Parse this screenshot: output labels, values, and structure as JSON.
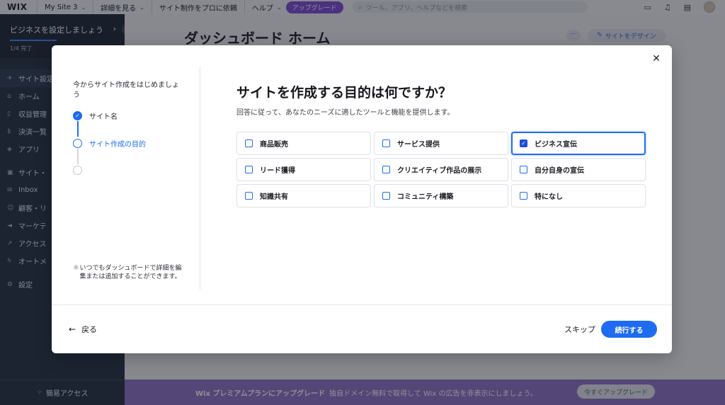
{
  "topbar": {
    "logo": "WIX",
    "site_name": "My Site 3",
    "menu": [
      "詳細を見る",
      "サイト制作をプロに依頼",
      "ヘルプ"
    ],
    "upgrade": "アップグレード",
    "search_placeholder": "ツール、アプリ、ヘルプなどを検索"
  },
  "sidebar": {
    "setup_title": "ビジネスを設定しましょう",
    "setup_progress": "1/4 完了",
    "setup_progress_fraction": 0.25,
    "items": [
      "サイト設定",
      "ホーム",
      "収益管理",
      "決済一覧",
      "アプリ",
      "サイト・",
      "Inbox",
      "顧客・リ",
      "マーケテ",
      "アクセス",
      "オートメ",
      "設定"
    ],
    "easy_access": "簡易アクセス"
  },
  "main": {
    "page_title": "ダッシュボード ホーム",
    "design_button": "サイトをデザイン"
  },
  "promo": {
    "strong": "Wix プレミアムプランにアップグレード",
    "text": "独自ドメイン無料で取得して Wix の広告を非表示にしましょう。",
    "button": "今すぐアップグレード"
  },
  "modal": {
    "steps_intro": "今からサイト作成をはじめましょう",
    "steps": [
      {
        "label": "サイト名",
        "state": "done"
      },
      {
        "label": "サイト作成の目的",
        "state": "current"
      },
      {
        "label": "",
        "state": "todo"
      }
    ],
    "tip": "いつでもダッシュボードで詳細を編集または追加することができます。",
    "question": "サイトを作成する目的は何ですか？",
    "subtitle": "回答に従って、あなたのニーズに適したツールと機能を提供します。",
    "options": [
      {
        "label": "商品販売",
        "checked": false
      },
      {
        "label": "サービス提供",
        "checked": false
      },
      {
        "label": "ビジネス宣伝",
        "checked": true
      },
      {
        "label": "リード獲得",
        "checked": false
      },
      {
        "label": "クリエイティブ作品の展示",
        "checked": false
      },
      {
        "label": "自分自身の宣伝",
        "checked": false
      },
      {
        "label": "知識共有",
        "checked": false
      },
      {
        "label": "コミュニティ構築",
        "checked": false
      },
      {
        "label": "特になし",
        "checked": false
      }
    ],
    "back": "戻る",
    "skip": "スキップ",
    "continue": "続行する"
  },
  "colors": {
    "accent": "#1d6cf2",
    "sidebar_bg": "#233141",
    "promo_bg": "#8f71c6",
    "upgrade_pill": "#7b4bd6"
  }
}
